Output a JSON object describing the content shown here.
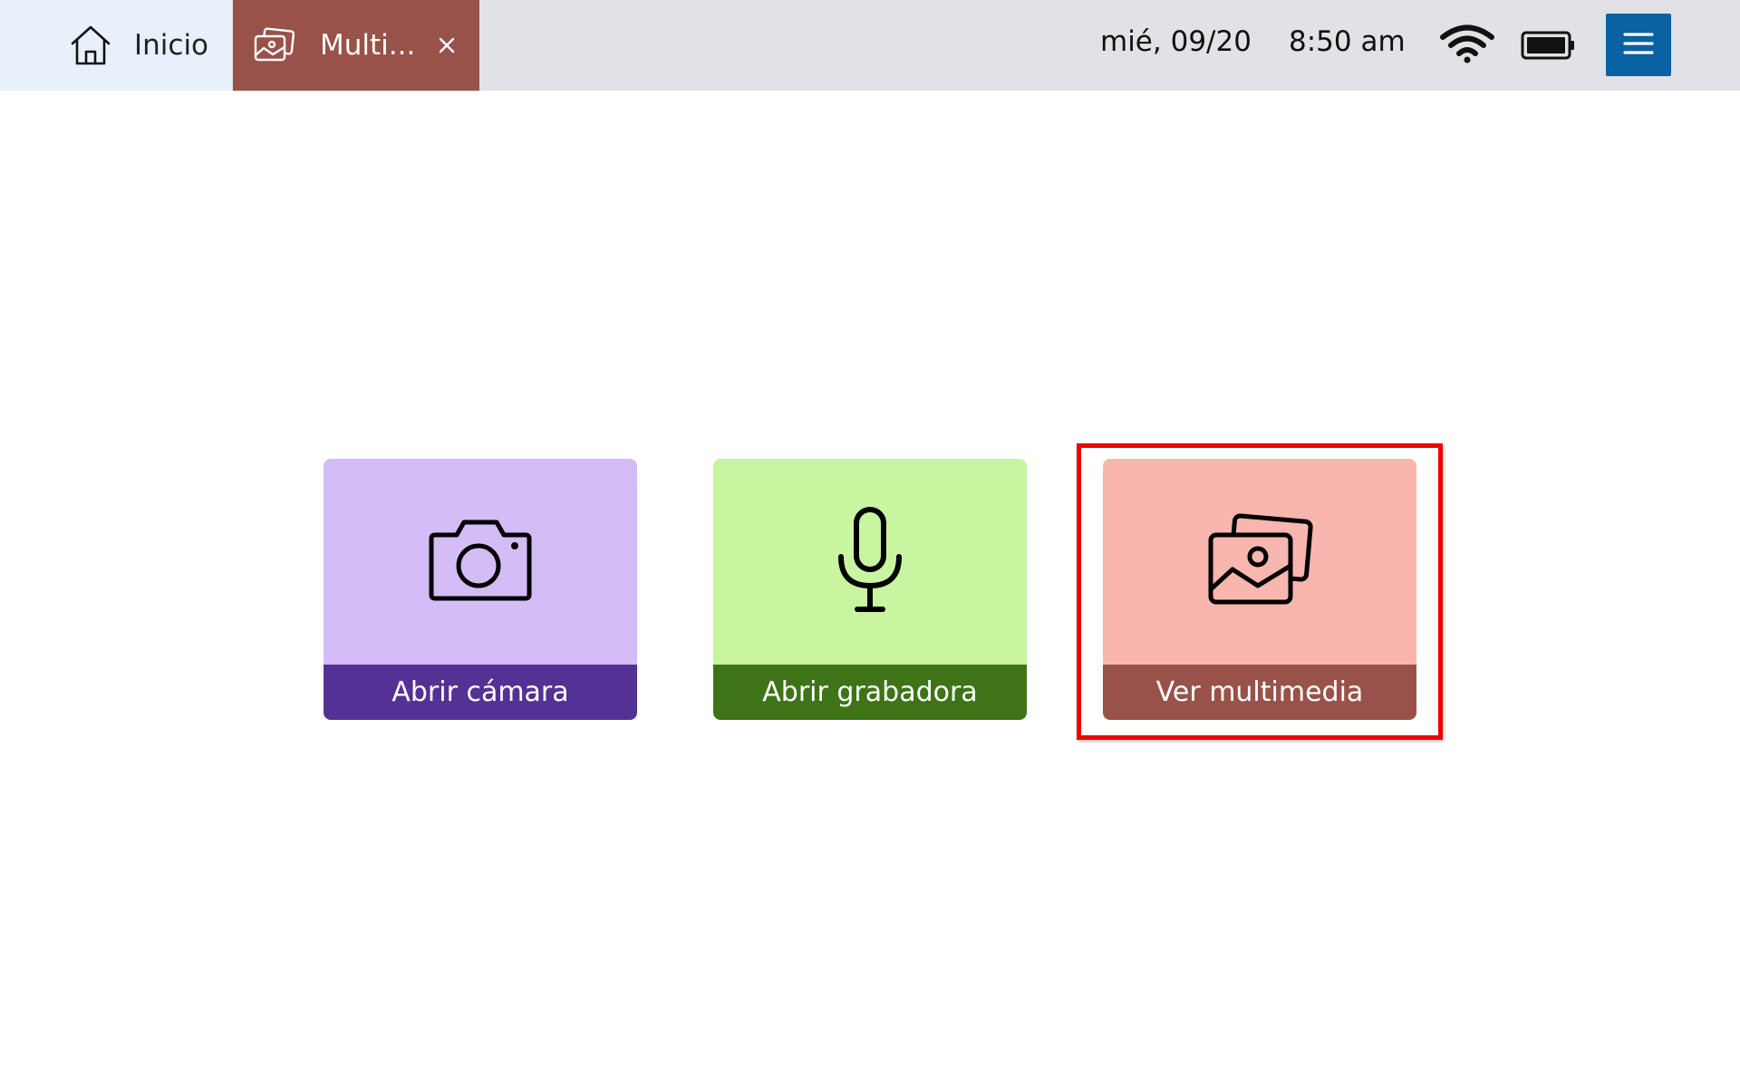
{
  "topbar": {
    "home_tab": {
      "label": "Inicio",
      "icon": "home-icon"
    },
    "active_tab": {
      "label": "Multi...",
      "icon": "images-icon",
      "close_icon": "close-icon"
    },
    "status": {
      "date": "mié, 09/20",
      "time": "8:50 am",
      "wifi_icon": "wifi-icon",
      "battery_icon": "battery-icon"
    },
    "menu_icon": "hamburger-menu-icon"
  },
  "cards": [
    {
      "label": "Abrir cámara",
      "icon": "camera-icon",
      "top_color": "#d4bcf7",
      "bottom_color": "#543194"
    },
    {
      "label": "Abrir grabadora",
      "icon": "microphone-icon",
      "top_color": "#c9f5a1",
      "bottom_color": "#3e7417"
    },
    {
      "label": "Ver multimedia",
      "icon": "images-icon",
      "top_color": "#f8b6ae",
      "bottom_color": "#98524a"
    }
  ],
  "highlight_color": "#ee0000"
}
